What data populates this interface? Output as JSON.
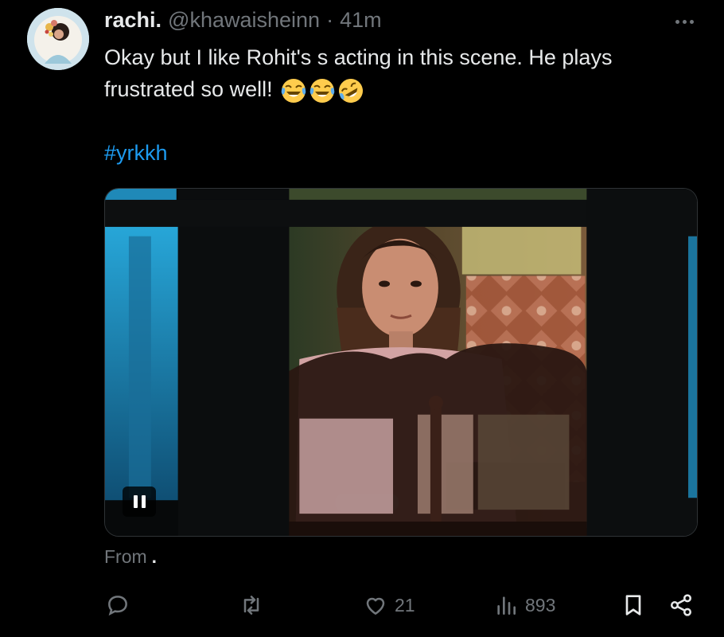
{
  "tweet": {
    "display_name": "rachi.",
    "handle": "@khawaisheinn",
    "separator": "·",
    "time": "41m",
    "text": "Okay but I like Rohit's s acting in this scene. He plays frustrated so well!",
    "emojis": [
      "face-with-tears-of-joy",
      "face-with-tears-of-joy",
      "rolling-on-the-floor-laughing"
    ],
    "hashtag": "#yrkkh",
    "from_label": "From",
    "from_suffix": "."
  },
  "media": {
    "type": "video",
    "state": "playing",
    "pause_icon": "pause-icon"
  },
  "actions": {
    "reply": {
      "icon": "reply-icon",
      "count": ""
    },
    "retweet": {
      "icon": "retweet-icon",
      "count": ""
    },
    "like": {
      "icon": "heart-icon",
      "count": "21"
    },
    "views": {
      "icon": "views-chart-icon",
      "count": "893"
    },
    "bookmark": {
      "icon": "bookmark-icon"
    },
    "share": {
      "icon": "share-icon"
    }
  },
  "colors": {
    "background": "#000000",
    "text": "#e7e9ea",
    "muted": "#71767b",
    "link": "#1d9bf0"
  }
}
